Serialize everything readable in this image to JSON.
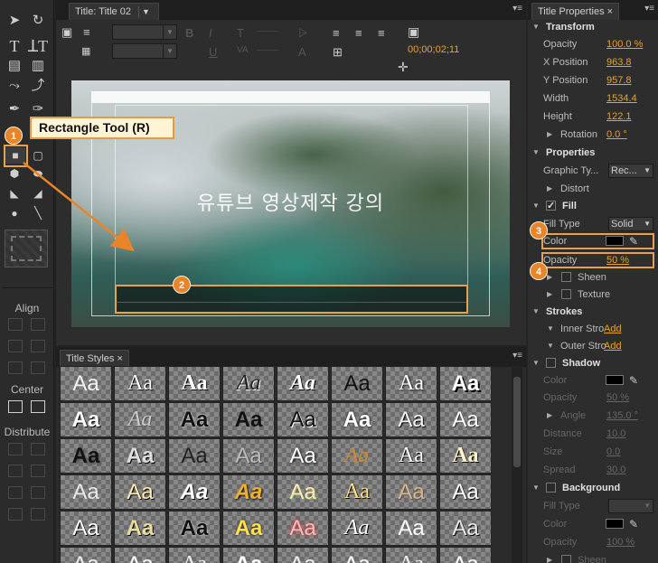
{
  "title_panel": {
    "tab_label": "Title: Title 02",
    "timecode": "00;00;02;11",
    "canvas_text": "유튜브 영상제작 강의"
  },
  "callout": {
    "tooltip": "Rectangle Tool (R)",
    "badges": [
      "1",
      "2",
      "3",
      "4"
    ]
  },
  "left_panel": {
    "align_label": "Align",
    "center_label": "Center",
    "distribute_label": "Distribute"
  },
  "styles_panel": {
    "tab_label": "Title Styles",
    "sample": "Aa"
  },
  "properties": {
    "tab_label": "Title Properties",
    "transform": {
      "label": "Transform",
      "opacity_label": "Opacity",
      "opacity": "100.0 %",
      "xpos_label": "X Position",
      "xpos": "963.8",
      "ypos_label": "Y Position",
      "ypos": "957.8",
      "width_label": "Width",
      "width": "1534.4",
      "height_label": "Height",
      "height": "122.1",
      "rotation_label": "Rotation",
      "rotation": "0.0 °"
    },
    "properties": {
      "label": "Properties",
      "graphic_type_label": "Graphic Ty...",
      "graphic_type": "Rec...",
      "distort_label": "Distort"
    },
    "fill": {
      "label": "Fill",
      "fill_type_label": "Fill Type",
      "fill_type": "Solid",
      "color_label": "Color",
      "opacity_label": "Opacity",
      "opacity": "50 %",
      "sheen_label": "Sheen",
      "texture_label": "Texture"
    },
    "strokes": {
      "label": "Strokes",
      "inner_label": "Inner Stro",
      "outer_label": "Outer Stro",
      "add": "Add"
    },
    "shadow": {
      "label": "Shadow",
      "color_label": "Color",
      "opacity_label": "Opacity",
      "opacity": "50 %",
      "angle_label": "Angle",
      "angle": "135.0 °",
      "distance_label": "Distance",
      "distance": "10.0",
      "size_label": "Size",
      "size": "0.0",
      "spread_label": "Spread",
      "spread": "30.0"
    },
    "background": {
      "label": "Background",
      "fill_type_label": "Fill Type",
      "color_label": "Color",
      "opacity_label": "Opacity",
      "opacity": "100 %",
      "sheen_label": "Sheen"
    }
  },
  "colors": {
    "accent": "#e8a04a",
    "value": "#e8a32a"
  }
}
